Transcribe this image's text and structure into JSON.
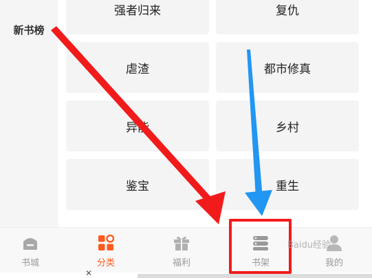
{
  "sidebar": {
    "items": [
      {
        "label": "新书榜"
      }
    ]
  },
  "tags": [
    {
      "label": "强者归来"
    },
    {
      "label": "复仇"
    },
    {
      "label": "虐渣"
    },
    {
      "label": "都市修真"
    },
    {
      "label": "异能"
    },
    {
      "label": "乡村"
    },
    {
      "label": "鉴宝"
    },
    {
      "label": "重生"
    }
  ],
  "tabbar": {
    "tabs": [
      {
        "label": "书城",
        "icon": "bookstore-icon",
        "active": false
      },
      {
        "label": "分类",
        "icon": "category-grid-icon",
        "active": true
      },
      {
        "label": "福利",
        "icon": "gift-icon",
        "active": false
      },
      {
        "label": "书架",
        "icon": "bookshelf-icon",
        "active": false
      },
      {
        "label": "我的",
        "icon": "user-icon",
        "active": false
      }
    ]
  },
  "colors": {
    "accent": "#ff5a1f",
    "inactive": "#9a9a9a",
    "annotation_red": "#f21b1b",
    "annotation_blue": "#2196f3"
  },
  "watermark": "Baidu经验"
}
